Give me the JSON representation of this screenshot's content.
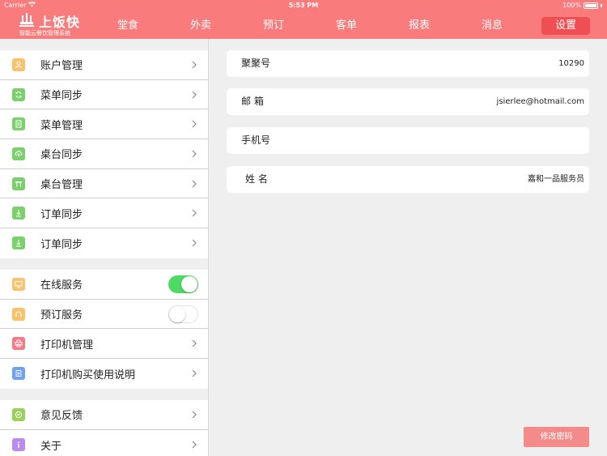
{
  "status_bar": {
    "carrier": "Carrier",
    "time": "5:53 PM",
    "battery": "100%"
  },
  "brand": {
    "name": "上饭快",
    "slogan": "智能云餐饮管理系统"
  },
  "nav": {
    "tabs": [
      {
        "label": "堂食"
      },
      {
        "label": "外卖"
      },
      {
        "label": "预订"
      },
      {
        "label": "客单"
      },
      {
        "label": "报表"
      },
      {
        "label": "消息"
      },
      {
        "label": "设置"
      }
    ],
    "active": "设置"
  },
  "menu": {
    "group1": [
      {
        "label": "账户管理",
        "icon": "user-icon",
        "color": "#f8c36a"
      },
      {
        "label": "菜单同步",
        "icon": "sync-icon",
        "color": "#7ad06a"
      },
      {
        "label": "菜单管理",
        "icon": "document-icon",
        "color": "#7ad06a"
      },
      {
        "label": "桌台同步",
        "icon": "cloud-upload-icon",
        "color": "#7ad06a"
      },
      {
        "label": "桌台管理",
        "icon": "table-icon",
        "color": "#7ad06a"
      },
      {
        "label": "订单同步",
        "icon": "download-icon",
        "color": "#7ad06a"
      },
      {
        "label": "订单同步",
        "icon": "download-icon",
        "color": "#7ad06a"
      }
    ],
    "group2": [
      {
        "label": "在线服务",
        "icon": "monitor-icon",
        "color": "#f8c36a",
        "toggle": "on"
      },
      {
        "label": "预订服务",
        "icon": "headset-icon",
        "color": "#f8c36a",
        "toggle": "off"
      },
      {
        "label": "打印机管理",
        "icon": "printer-icon",
        "color": "#f47a86"
      },
      {
        "label": "打印机购买使用说明",
        "icon": "manual-icon",
        "color": "#6fa2ef"
      }
    ],
    "group3": [
      {
        "label": "意见反馈",
        "icon": "feedback-icon",
        "color": "#9bd05a"
      },
      {
        "label": "关于",
        "icon": "info-icon",
        "color": "#b98cf0"
      }
    ]
  },
  "profile": {
    "fields": [
      {
        "label": "聚聚号",
        "value": "10290"
      },
      {
        "label": "邮 箱",
        "value": "jsierlee@hotmail.com"
      },
      {
        "label": "手机号",
        "value": ""
      },
      {
        "label": "姓 名",
        "value": "嘉和一品服务员"
      }
    ],
    "change_password": "修改密码"
  }
}
